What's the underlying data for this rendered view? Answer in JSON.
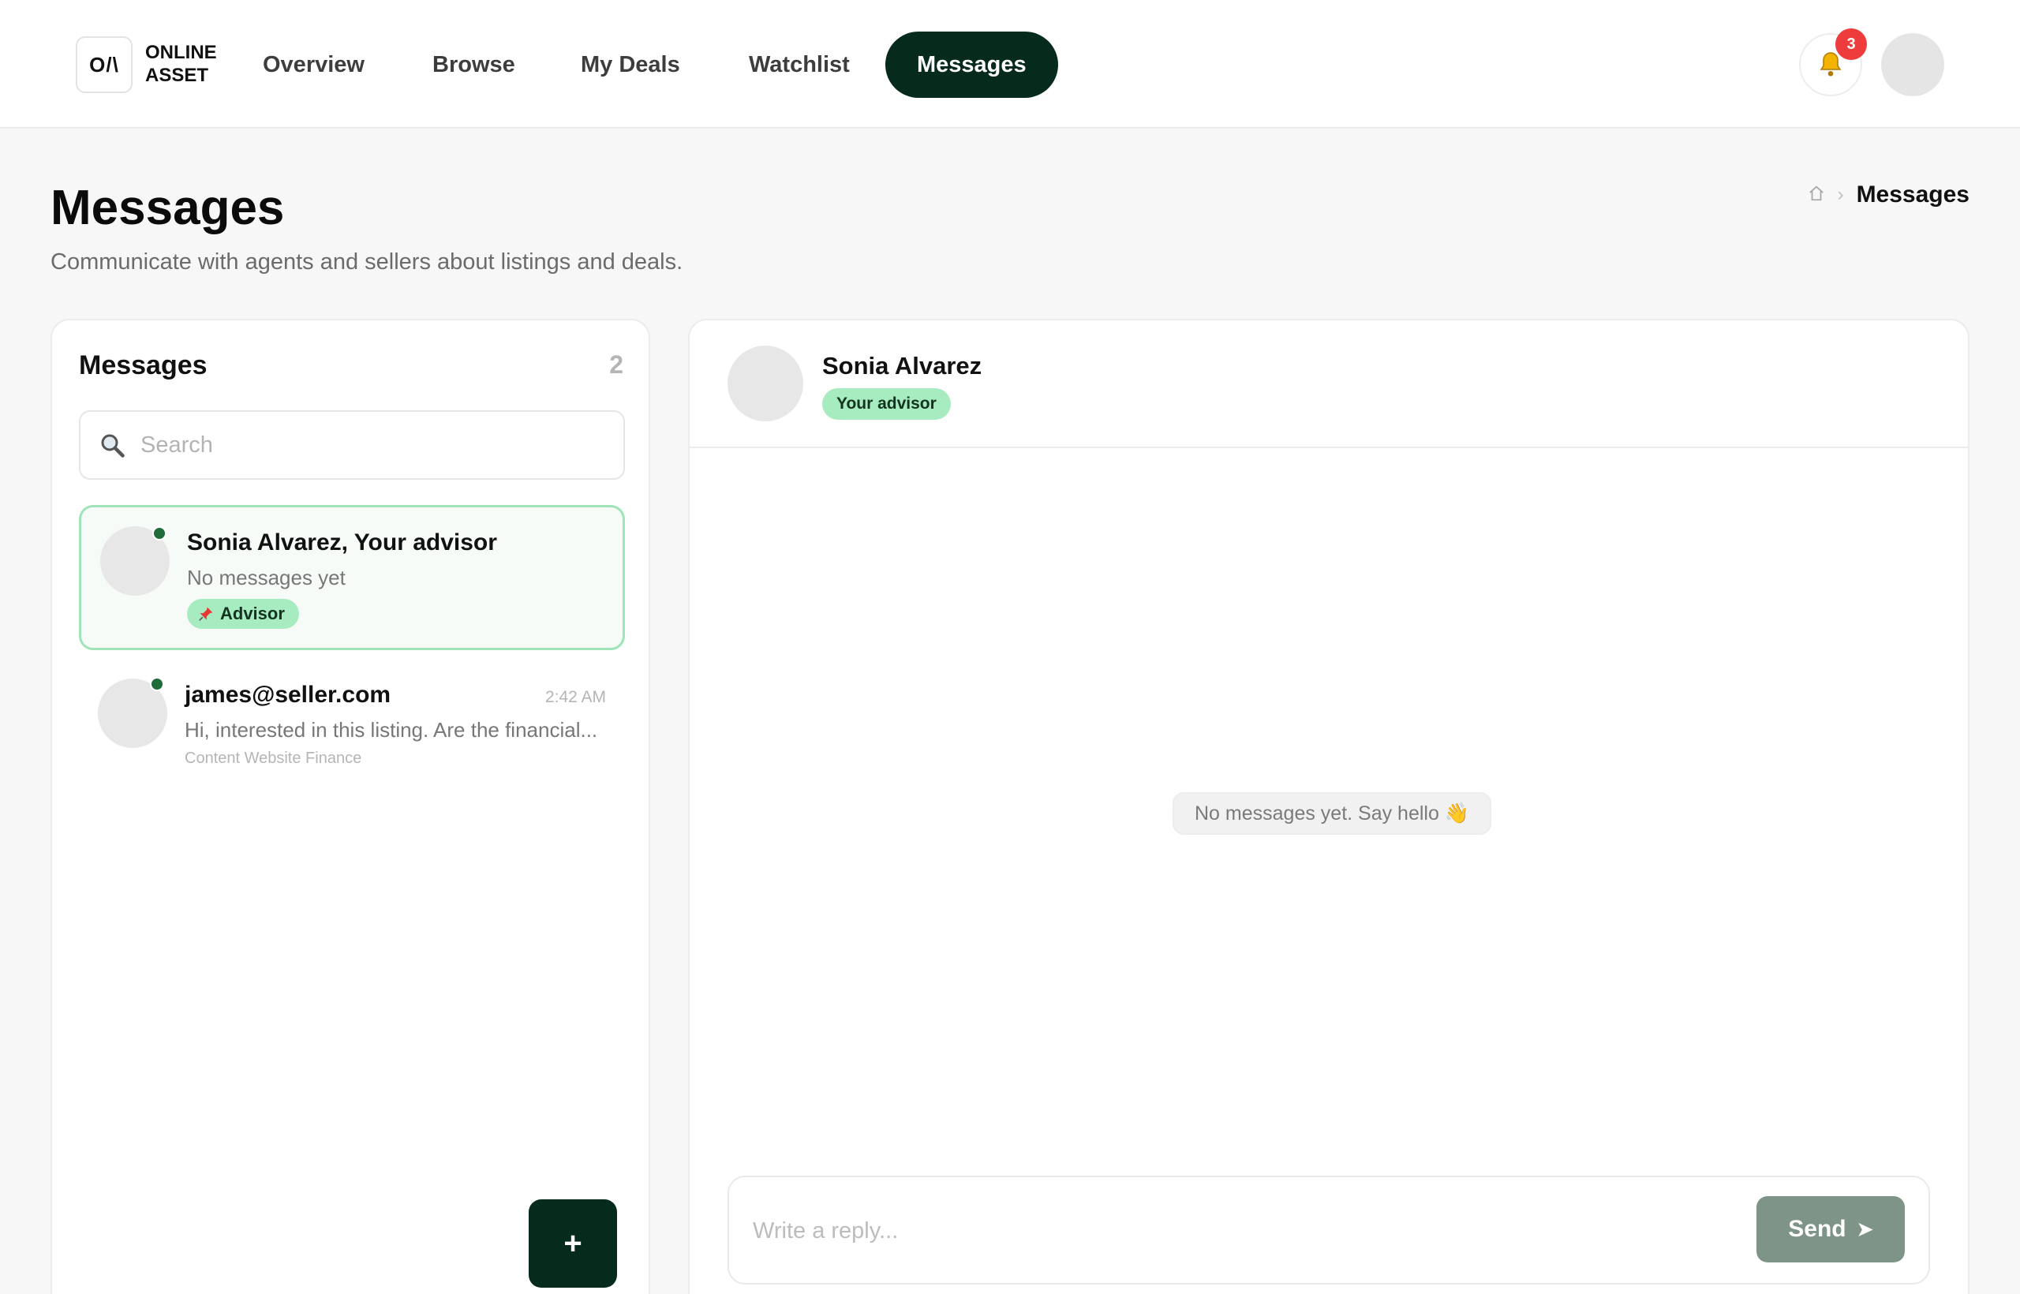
{
  "brand": {
    "mark": "O/\\",
    "line1": "ONLINE",
    "line2": "ASSET"
  },
  "nav": [
    {
      "label": "Overview",
      "active": false
    },
    {
      "label": "Browse",
      "active": false
    },
    {
      "label": "My Deals",
      "active": false
    },
    {
      "label": "Watchlist",
      "active": false
    },
    {
      "label": "Messages",
      "active": true
    }
  ],
  "notifications": {
    "count": "3",
    "icon": "bell-icon"
  },
  "page": {
    "title": "Messages",
    "subtitle": "Communicate with agents and sellers about listings and deals."
  },
  "breadcrumb": {
    "home_icon": "home-icon",
    "separator": "›",
    "current": "Messages"
  },
  "inbox": {
    "title": "Messages",
    "count": "2",
    "search_placeholder": "Search",
    "conversations": [
      {
        "name": "Sonia Alvarez, Your advisor",
        "preview": "No messages yet",
        "tag": "Advisor",
        "tag_icon": "pin-icon",
        "online": true,
        "selected": true
      },
      {
        "name": "james@seller.com",
        "preview": "Hi, interested in this listing. Are the financial...",
        "time": "2:42 AM",
        "listing": "Content Website Finance",
        "online": true,
        "selected": false
      }
    ],
    "new_button": "+"
  },
  "chat": {
    "name": "Sonia Alvarez",
    "role": "Your advisor",
    "empty_text": "No messages yet. Say hello 👋",
    "reply_placeholder": "Write a reply...",
    "send_label": "Send",
    "send_icon": "➤"
  },
  "colors": {
    "primary_dark": "#062a1c",
    "accent_green": "#a7ecc0",
    "badge_red": "#ee3b3b",
    "send_disabled": "#7e9486",
    "online": "#1f6b3a"
  }
}
